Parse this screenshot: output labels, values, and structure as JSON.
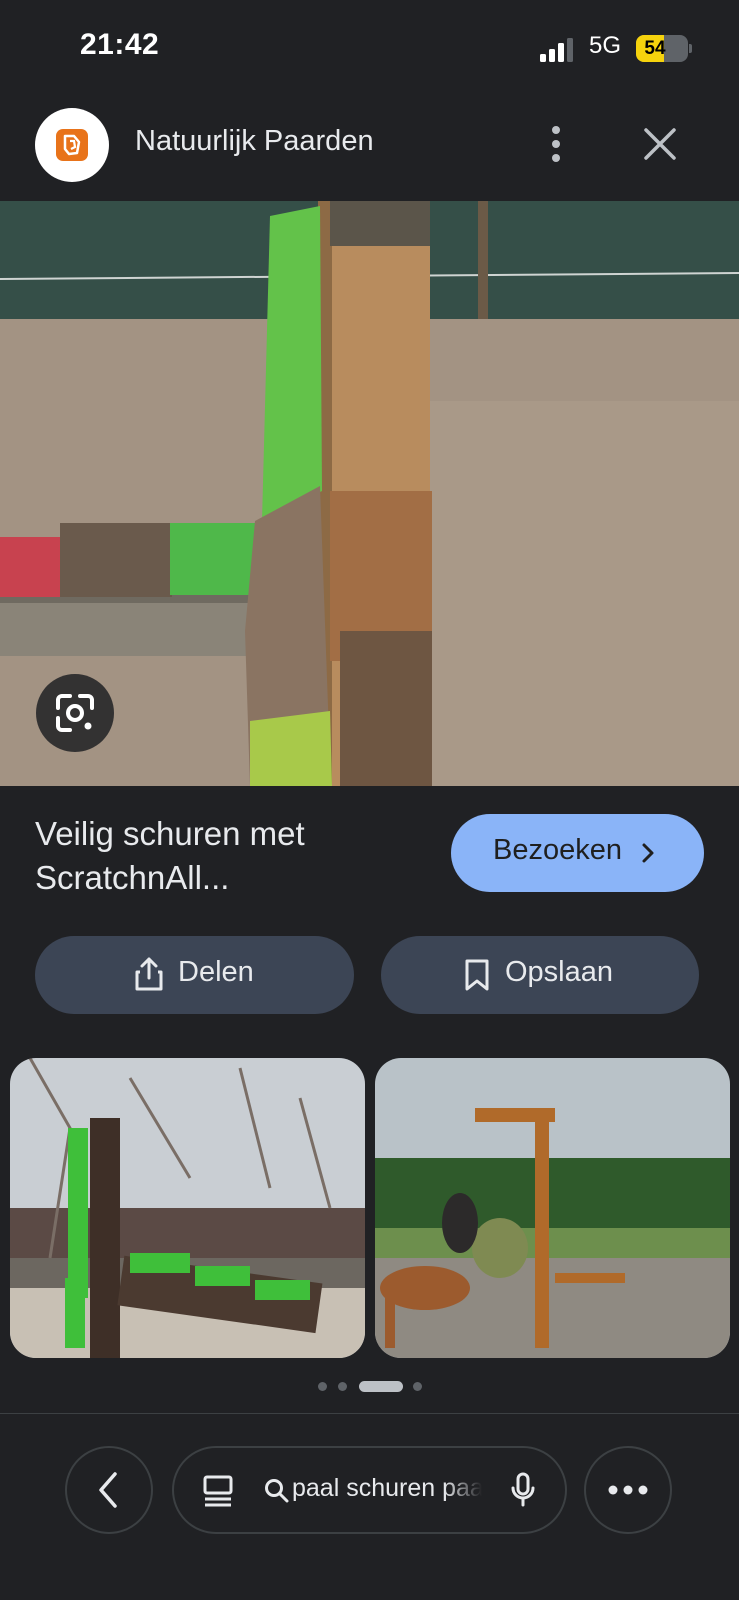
{
  "status_bar": {
    "time": "21:42",
    "network": "5G",
    "battery_level": "54",
    "battery_fraction": 0.54
  },
  "site": {
    "name": "Natuurlijk Paarden",
    "logo_icon": "natuurlijk-paarden-logo"
  },
  "header_icons": {
    "menu": "more-vert-icon",
    "close": "close-icon"
  },
  "result": {
    "caption": "Veilig schuren met ScratchnAll...",
    "visit_label": "Bezoeken",
    "share_label": "Delen",
    "save_label": "Opslaan"
  },
  "carousel": {
    "dot_count": 4,
    "active_index": 2
  },
  "toolbar": {
    "search_query": "paal schuren paarden"
  },
  "colors": {
    "background": "#202124",
    "accent": "#8ab4f8",
    "pill": "#3c4555",
    "brand_orange": "#e8731a"
  }
}
